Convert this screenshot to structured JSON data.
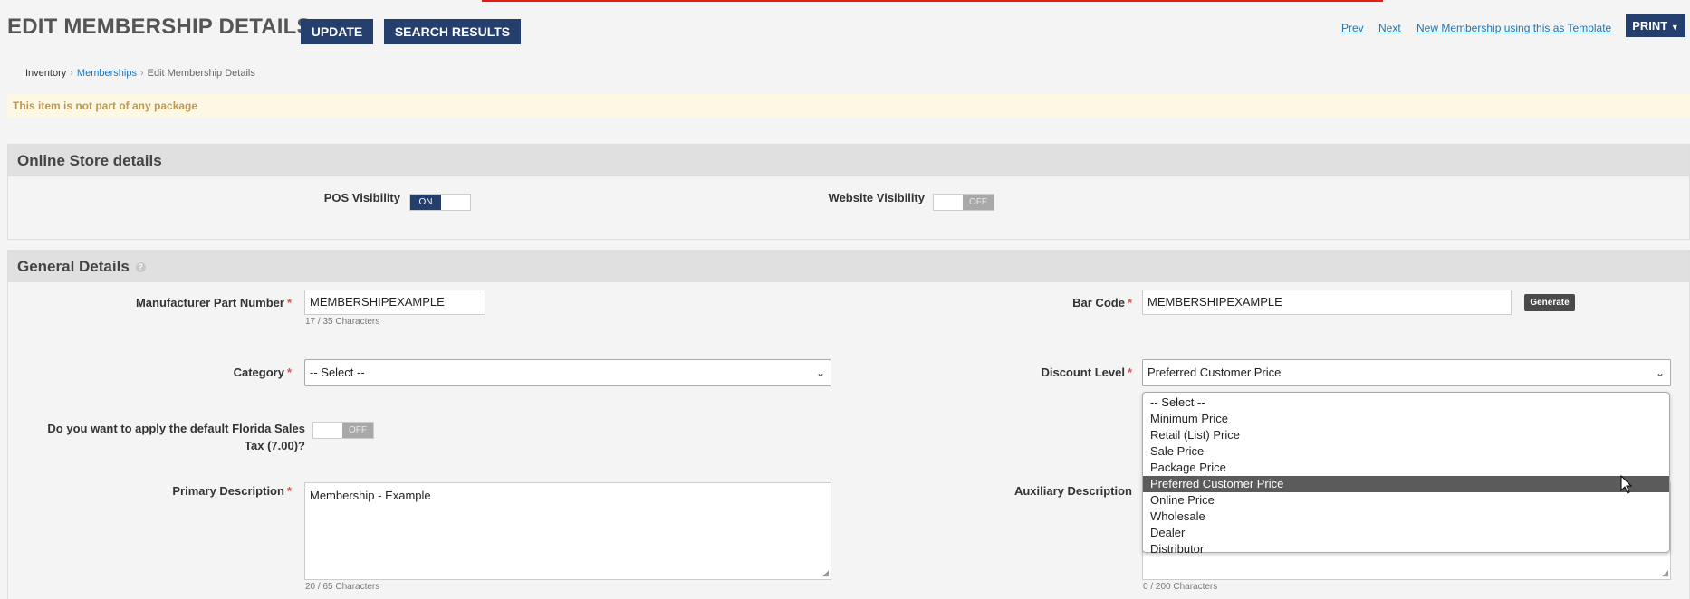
{
  "header": {
    "title": "EDIT MEMBERSHIP DETAILS",
    "update_label": "UPDATE",
    "search_results_label": "SEARCH RESULTS",
    "prev_label": "Prev",
    "next_label": "Next",
    "new_template_label": "New Membership using this as Template",
    "print_label": "PRINT"
  },
  "breadcrumb": {
    "items": [
      "Inventory",
      "Memberships",
      "Edit Membership Details"
    ]
  },
  "alert": {
    "text": "This item is not part of any package"
  },
  "online_store": {
    "title": "Online Store details",
    "pos_visibility_label": "POS Visibility",
    "pos_visibility_state": "ON",
    "website_visibility_label": "Website Visibility",
    "website_visibility_state": "OFF"
  },
  "general": {
    "title": "General Details",
    "mpn_label": "Manufacturer Part Number",
    "mpn_value": "MEMBERSHIPEXAMPLE",
    "mpn_count": "17 / 35 Characters",
    "barcode_label": "Bar Code",
    "barcode_value": "MEMBERSHIPEXAMPLE",
    "generate_label": "Generate",
    "category_label": "Category",
    "category_value": "-- Select --",
    "discount_label": "Discount Level",
    "discount_value": "Preferred Customer Price",
    "discount_options": [
      "-- Select --",
      "Minimum Price",
      "Retail (List) Price",
      "Sale Price",
      "Package Price",
      "Preferred Customer Price",
      "Online Price",
      "Wholesale",
      "Dealer",
      "Distributor"
    ],
    "discount_highlighted_index": 5,
    "tax_label_line1": "Do you want to apply the default Florida Sales",
    "tax_label_line2": "Tax (7.00)?",
    "tax_state": "OFF",
    "primary_desc_label": "Primary Description",
    "primary_desc_value": "Membership - Example",
    "primary_desc_count": "20 / 65 Characters",
    "aux_desc_label": "Auxiliary Description",
    "aux_desc_count": "0 / 200 Characters"
  },
  "colors": {
    "primary_button": "#243e6d",
    "link": "#1d75b3",
    "alert_bg": "#fdf8e4",
    "alert_text": "#c09853",
    "required": "#d9534f"
  }
}
